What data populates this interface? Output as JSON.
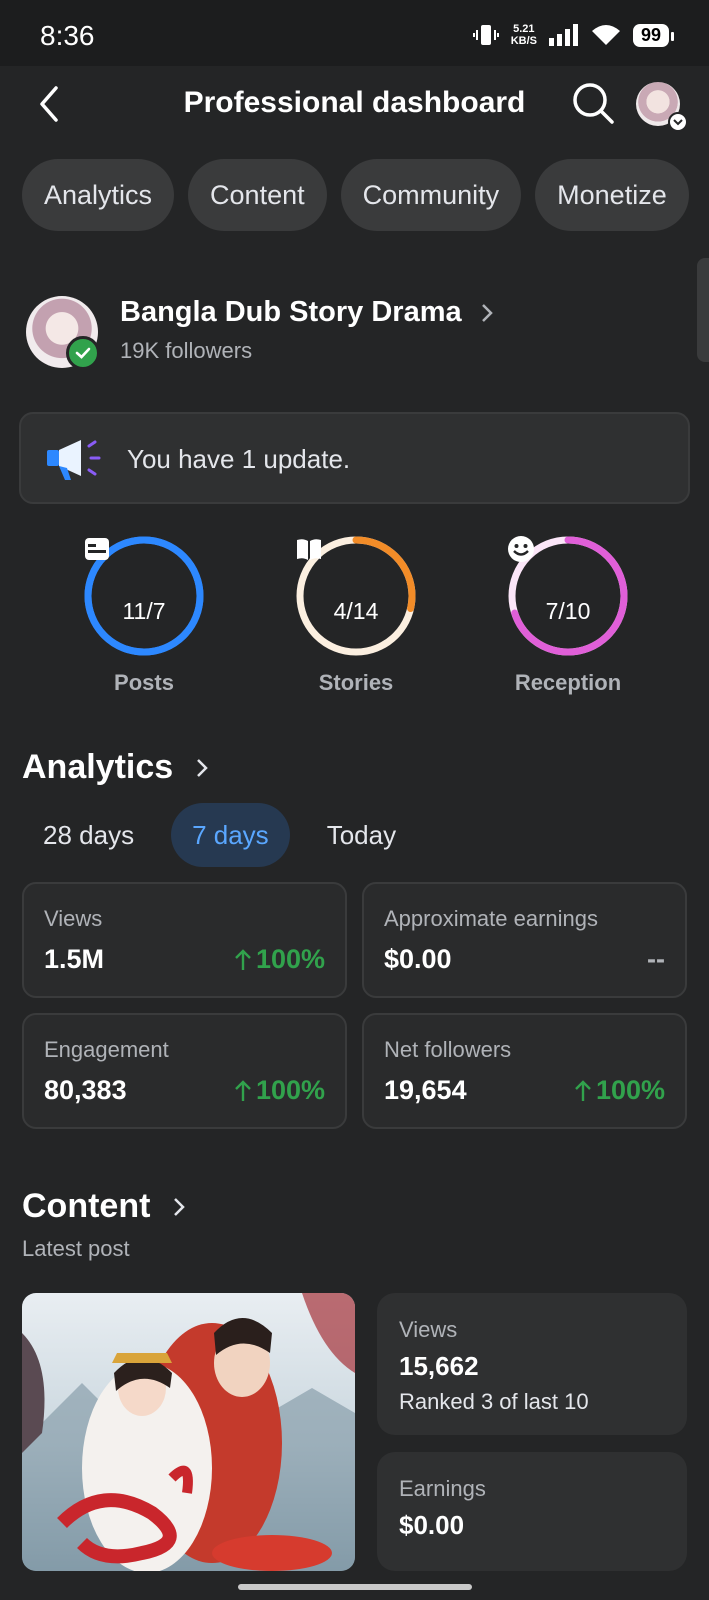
{
  "status_bar": {
    "time": "8:36",
    "net_speed_value": "5.21",
    "net_speed_unit": "KB/S",
    "battery": "99"
  },
  "header": {
    "title": "Professional dashboard"
  },
  "tabs": [
    {
      "label": "Analytics"
    },
    {
      "label": "Content"
    },
    {
      "label": "Community"
    },
    {
      "label": "Monetize"
    }
  ],
  "profile": {
    "name": "Bangla Dub Story Drama",
    "followers": "19K followers"
  },
  "update": {
    "text": "You have 1 update."
  },
  "goals": [
    {
      "label": "Posts",
      "value": "11/7",
      "icon": "post-icon",
      "progress": 1.0,
      "color": "#2d88ff",
      "track": "#2d88ff"
    },
    {
      "label": "Stories",
      "value": "4/14",
      "icon": "book-icon",
      "progress": 0.2857,
      "color": "#f28c28",
      "track": "#fbefe0"
    },
    {
      "label": "Reception",
      "value": "7/10",
      "icon": "smile-icon",
      "progress": 0.7,
      "color": "#e05fd8",
      "track": "#fbe6f8"
    }
  ],
  "analytics": {
    "title": "Analytics",
    "ranges": [
      "28 days",
      "7 days",
      "Today"
    ],
    "selected_range": "7 days",
    "metrics": [
      {
        "label": "Views",
        "value": "1.5M",
        "change": "100%"
      },
      {
        "label": "Approximate earnings",
        "value": "$0.00",
        "change": "--"
      },
      {
        "label": "Engagement",
        "value": "80,383",
        "change": "100%"
      },
      {
        "label": "Net followers",
        "value": "19,654",
        "change": "100%"
      }
    ]
  },
  "content": {
    "title": "Content",
    "subtitle": "Latest post",
    "views_label": "Views",
    "views_value": "15,662",
    "views_rank": "Ranked 3 of last 10",
    "earnings_label": "Earnings",
    "earnings_value": "$0.00"
  },
  "colors": {
    "background": "#242526",
    "accent_blue": "#2d88ff",
    "positive_green": "#31a24c"
  }
}
